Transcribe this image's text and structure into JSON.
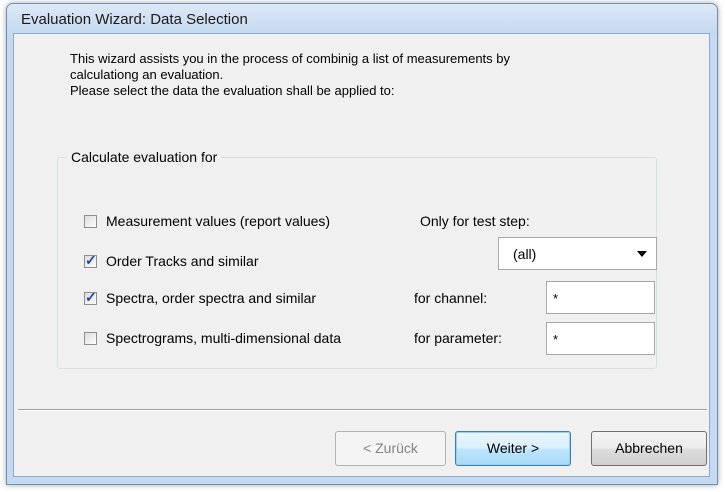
{
  "window": {
    "title": "Evaluation Wizard: Data Selection"
  },
  "intro": {
    "line1": "This wizard assists you in the process of combinig a list of measurements by",
    "line2": "calculationg an evaluation.",
    "line3": "Please select the data the evaluation shall be applied to:"
  },
  "group": {
    "legend": "Calculate evaluation for",
    "checkboxes": [
      {
        "label": "Measurement values (report values)",
        "checked": false
      },
      {
        "label": "Order Tracks and similar",
        "checked": true
      },
      {
        "label": "Spectra, order spectra and similar",
        "checked": true
      },
      {
        "label": "Spectrograms, multi-dimensional data",
        "checked": false
      }
    ],
    "test_step_label": "Only for test step:",
    "test_step_value": "(all)",
    "channel_label": "for channel:",
    "channel_value": "*",
    "parameter_label": "for parameter:",
    "parameter_value": "*"
  },
  "buttons": {
    "back": "< Zurück",
    "next": "Weiter >",
    "cancel": "Abbrechen"
  }
}
